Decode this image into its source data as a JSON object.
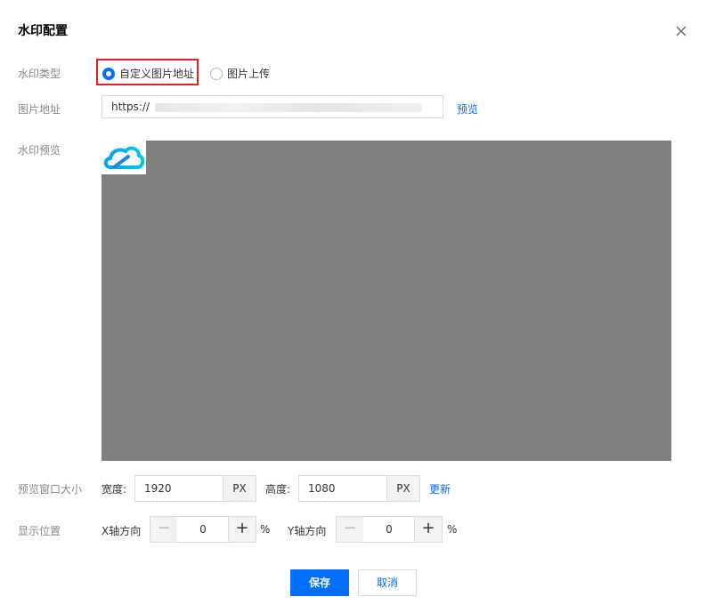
{
  "dialog": {
    "title": "水印配置",
    "close_icon": "close-icon"
  },
  "watermark_type": {
    "label": "水印类型",
    "options": [
      {
        "label": "自定义图片地址",
        "selected": true
      },
      {
        "label": "图片上传",
        "selected": false
      }
    ]
  },
  "image_url": {
    "label": "图片地址",
    "value": "https://",
    "preview_link": "预览"
  },
  "watermark_preview": {
    "label": "水印预览",
    "logo_icon": "cloud-logo-icon",
    "background_color": "#808080"
  },
  "preview_window": {
    "label": "预览窗口大小",
    "width_label": "宽度:",
    "width_value": "1920",
    "width_unit": "PX",
    "height_label": "高度:",
    "height_value": "1080",
    "height_unit": "PX",
    "update_link": "更新"
  },
  "position": {
    "label": "显示位置",
    "x_label": "X轴方向",
    "x_value": "0",
    "y_label": "Y轴方向",
    "y_value": "0",
    "unit": "%",
    "minus_icon": "minus-icon",
    "plus_icon": "plus-icon"
  },
  "footer": {
    "save_label": "保存",
    "cancel_label": "取消"
  },
  "colors": {
    "accent": "#006eff",
    "highlight": "#e02020"
  }
}
